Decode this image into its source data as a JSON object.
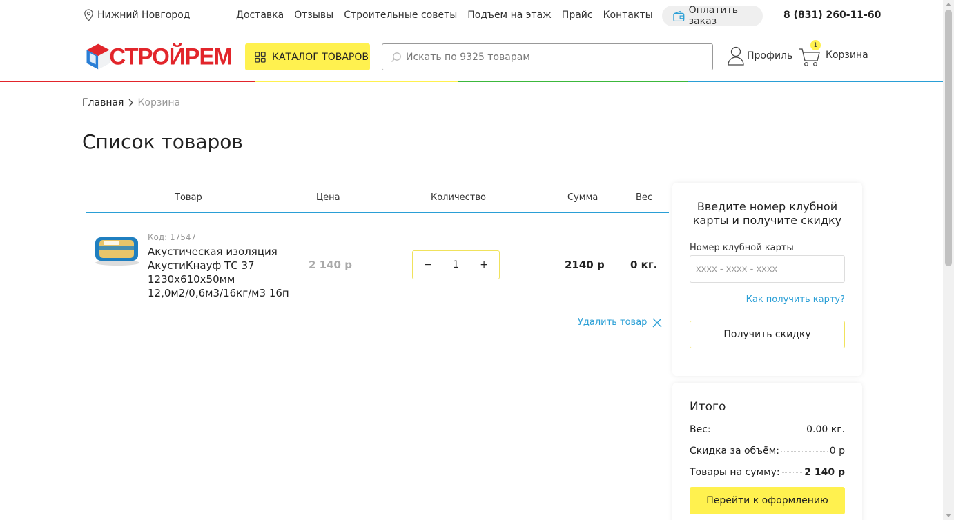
{
  "topbar": {
    "city": "Нижний Новгород",
    "nav": [
      "Доставка",
      "Отзывы",
      "Строительные советы",
      "Подъем на этаж",
      "Прайс",
      "Контакты"
    ],
    "pay_label": "Оплатить заказ",
    "phone": "8 (831) 260-11-60"
  },
  "header": {
    "logo_text": "СТРОЙРЕМ",
    "catalog_label": "КАТАЛОГ ТОВАРОВ",
    "search_placeholder": "Искать по 9325 товарам",
    "profile_label": "Профиль",
    "cart_label": "Корзина",
    "cart_count": "1"
  },
  "colors": {
    "accent_yellow": "#fff14f",
    "link_blue": "#2a9fd6",
    "brand_red": "#e2252b",
    "stripe": [
      "#e2252b",
      "#fff14f",
      "#3cb83c",
      "#2a9fd6"
    ]
  },
  "breadcrumb": {
    "home": "Главная",
    "current": "Корзина"
  },
  "page_title": "Список товаров",
  "table": {
    "headers": {
      "product": "Товар",
      "price": "Цена",
      "quantity": "Количество",
      "sum": "Сумма",
      "weight": "Вес"
    },
    "items": [
      {
        "code": "Код: 17547",
        "name": "Акустическая изоляция АкустиКнауф ТС 37 1230х610х50мм 12,0м2/0,6м3/16кг/м3 16п",
        "price": "2 140 р",
        "quantity": "1",
        "sum": "2140 р",
        "weight": "0 кг."
      }
    ],
    "delete_label": "Удалить товар"
  },
  "club_card": {
    "title": "Введите номер клубной карты и получите скидку",
    "label": "Номер клубной карты",
    "placeholder": "xxxx - xxxx - xxxx",
    "how_link": "Как получить карту?",
    "button": "Получить скидку"
  },
  "summary": {
    "title": "Итого",
    "weight_label": "Вес:",
    "weight_value": "0.00 кг.",
    "discount_label": "Скидка за объём:",
    "discount_value": "0 р",
    "goods_label": "Товары на сумму:",
    "goods_value": "2 140 р",
    "checkout_button": "Перейти к оформлению"
  }
}
